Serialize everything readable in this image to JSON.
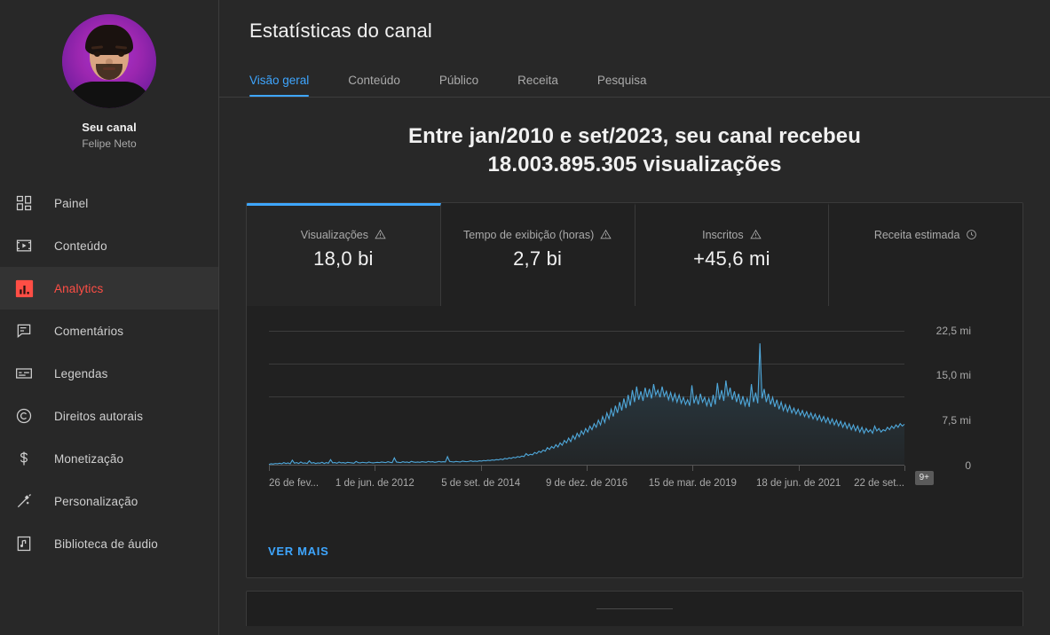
{
  "sidebar": {
    "channel": {
      "label": "Seu canal",
      "name": "Felipe Neto"
    },
    "items": [
      {
        "label": "Painel",
        "icon": "dashboard-icon"
      },
      {
        "label": "Conteúdo",
        "icon": "video-icon"
      },
      {
        "label": "Analytics",
        "icon": "analytics-icon"
      },
      {
        "label": "Comentários",
        "icon": "comment-icon"
      },
      {
        "label": "Legendas",
        "icon": "subtitles-icon"
      },
      {
        "label": "Direitos autorais",
        "icon": "copyright-icon"
      },
      {
        "label": "Monetização",
        "icon": "dollar-icon"
      },
      {
        "label": "Personalização",
        "icon": "wand-icon"
      },
      {
        "label": "Biblioteca de áudio",
        "icon": "music-note-icon"
      }
    ],
    "active_index": 2
  },
  "header": {
    "title": "Estatísticas do canal",
    "tabs": [
      {
        "label": "Visão geral"
      },
      {
        "label": "Conteúdo"
      },
      {
        "label": "Público"
      },
      {
        "label": "Receita"
      },
      {
        "label": "Pesquisa"
      }
    ],
    "active_tab_index": 0
  },
  "overview": {
    "headline_line1": "Entre jan/2010 e set/2023, seu canal recebeu",
    "headline_line2": "18.003.895.305 visualizações",
    "metrics": [
      {
        "label": "Visualizações",
        "value": "18,0 bi",
        "icon": "warning-icon",
        "selected": true
      },
      {
        "label": "Tempo de exibição (horas)",
        "value": "2,7 bi",
        "icon": "warning-icon",
        "selected": false
      },
      {
        "label": "Inscritos",
        "value": "+45,6 mi",
        "icon": "warning-icon",
        "selected": false
      },
      {
        "label": "Receita estimada",
        "value": "",
        "icon": "clock-icon",
        "selected": false
      }
    ],
    "see_more_label": "VER MAIS",
    "chart_badge": "9+"
  },
  "colors": {
    "accent_blue": "#3ea6ff",
    "active_red": "#ff4e45",
    "chart_line": "#4fa8db",
    "page_bg": "#282828",
    "card_bg": "#212121"
  },
  "chart_data": {
    "type": "area",
    "title": "Visualizações",
    "xlabel": "",
    "ylabel": "",
    "ylim": [
      0,
      22.5
    ],
    "yunit": "mi",
    "grid": true,
    "legend": "none",
    "ytick_labels": [
      "22,5 mi",
      "15,0 mi",
      "7,5 mi",
      "0"
    ],
    "ytick_values": [
      22.5,
      15.0,
      7.5,
      0
    ],
    "xtick_labels": [
      "26 de fev...",
      "1 de jun. de 2012",
      "5 de set. de 2014",
      "9 de dez. de 2016",
      "15 de mar. de 2019",
      "18 de jun. de 2021",
      "22 de set..."
    ],
    "series": [
      {
        "name": "Visualizações",
        "color": "#4fa8db",
        "values": [
          0.2,
          0.3,
          0.25,
          0.35,
          0.3,
          0.4,
          0.3,
          0.5,
          0.35,
          0.45,
          0.3,
          0.9,
          0.4,
          0.5,
          0.35,
          0.6,
          0.4,
          0.45,
          0.35,
          0.8,
          0.4,
          0.5,
          0.35,
          0.45,
          0.4,
          0.55,
          0.35,
          0.5,
          0.4,
          1.0,
          0.45,
          0.5,
          0.4,
          0.6,
          0.45,
          0.5,
          0.4,
          0.55,
          0.5,
          0.45,
          0.4,
          0.7,
          0.5,
          0.45,
          0.55,
          0.5,
          0.45,
          0.6,
          0.5,
          0.45,
          0.5,
          0.55,
          0.5,
          0.6,
          0.55,
          0.5,
          0.65,
          0.55,
          0.5,
          1.3,
          0.6,
          0.55,
          0.5,
          0.65,
          0.55,
          0.6,
          0.5,
          0.7,
          0.6,
          0.55,
          0.6,
          0.55,
          0.65,
          0.6,
          0.55,
          0.7,
          0.6,
          0.65,
          0.55,
          0.6,
          0.7,
          0.6,
          0.65,
          0.6,
          1.5,
          0.7,
          0.65,
          0.6,
          0.7,
          0.65,
          0.6,
          0.75,
          0.7,
          0.65,
          0.7,
          0.8,
          0.7,
          0.75,
          0.7,
          0.8,
          0.75,
          0.85,
          0.8,
          0.9,
          0.85,
          0.95,
          0.9,
          1.0,
          0.95,
          1.1,
          1.0,
          1.2,
          1.1,
          1.3,
          1.2,
          1.4,
          1.3,
          1.5,
          1.4,
          1.6,
          1.5,
          2.0,
          1.7,
          1.9,
          1.8,
          2.2,
          2.0,
          2.4,
          2.2,
          2.6,
          2.4,
          3.0,
          2.7,
          3.2,
          2.9,
          3.5,
          3.1,
          3.8,
          3.4,
          4.2,
          3.8,
          4.6,
          4.0,
          5.0,
          4.4,
          5.4,
          4.8,
          5.8,
          5.2,
          6.2,
          5.6,
          6.6,
          6.0,
          7.0,
          6.4,
          7.6,
          6.8,
          8.2,
          7.2,
          8.8,
          7.8,
          9.4,
          8.2,
          10.0,
          8.8,
          10.6,
          9.2,
          11.2,
          9.6,
          11.8,
          10.0,
          12.6,
          10.6,
          13.2,
          11.0,
          12.4,
          10.8,
          13.0,
          11.4,
          12.8,
          11.2,
          13.6,
          11.8,
          12.6,
          11.4,
          13.2,
          11.6,
          12.4,
          11.0,
          12.2,
          10.8,
          12.0,
          10.6,
          11.8,
          10.4,
          11.4,
          10.2,
          11.0,
          10.0,
          13.4,
          10.4,
          11.6,
          10.2,
          12.0,
          10.6,
          11.4,
          10.0,
          11.2,
          9.8,
          11.8,
          10.2,
          13.8,
          11.0,
          12.6,
          10.8,
          14.2,
          11.6,
          13.0,
          11.0,
          12.4,
          10.6,
          12.0,
          10.2,
          11.6,
          10.0,
          11.2,
          9.8,
          13.6,
          10.6,
          12.2,
          10.4,
          20.4,
          11.2,
          12.8,
          10.6,
          12.0,
          10.2,
          11.4,
          9.8,
          11.0,
          9.4,
          10.6,
          9.2,
          10.2,
          9.0,
          10.0,
          8.8,
          9.6,
          8.6,
          9.4,
          8.4,
          9.2,
          8.2,
          9.0,
          8.0,
          8.8,
          7.8,
          8.6,
          7.6,
          8.4,
          7.4,
          8.2,
          7.2,
          8.0,
          7.0,
          7.8,
          6.8,
          7.6,
          6.6,
          7.4,
          6.4,
          7.2,
          6.2,
          7.0,
          6.0,
          6.8,
          5.8,
          6.6,
          5.6,
          6.4,
          5.4,
          6.2,
          5.6,
          6.0,
          5.4,
          6.6,
          5.8,
          6.2,
          5.6,
          6.0,
          5.8,
          6.4,
          6.0,
          6.6,
          6.2,
          6.8,
          6.4,
          7.0,
          6.6,
          6.9
        ]
      }
    ]
  }
}
